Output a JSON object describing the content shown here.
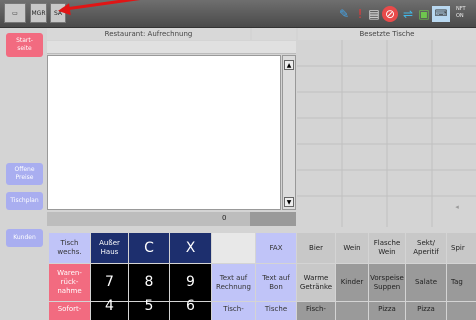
{
  "topbar": {
    "small_buttons": [
      "MGR",
      "SA"
    ],
    "status_text": [
      "NFT",
      "ON"
    ]
  },
  "sidebar": {
    "start": "Start-\nseite",
    "offene": "Offene\nPreise",
    "tischplan": "Tischplan",
    "kunden": "Kunden"
  },
  "headers": {
    "left": "Restaurant: Aufrechnung",
    "right": "Besetzte Tische"
  },
  "order": {
    "total": "0"
  },
  "keypad": {
    "row1": [
      "Tisch wechs.",
      "Außer Haus",
      "C",
      "X",
      "",
      "FAX"
    ],
    "row2": [
      "Waren-rück-nahme",
      "7",
      "8",
      "9",
      "Text auf Rechnung",
      "Text auf Bon"
    ],
    "row3": [
      "Sofort-",
      "4",
      "5",
      "6",
      "Tisch-",
      "Tische"
    ]
  },
  "categories": {
    "row1": [
      "Bier",
      "Wein",
      "Flasche Wein",
      "Sekt/ Aperitif",
      "Spir"
    ],
    "row2": [
      "Warme Getränke",
      "Kinder",
      "Vorspeise Suppen",
      "Salate",
      "Tag"
    ],
    "row3": [
      "Fisch-",
      "",
      "Pizza",
      "Pizza",
      ""
    ]
  },
  "colors": {
    "accent_pink": "#f26b80",
    "lavender": "#a9aef0",
    "navy": "#1d2f6e",
    "arrow_red": "#e01515"
  }
}
